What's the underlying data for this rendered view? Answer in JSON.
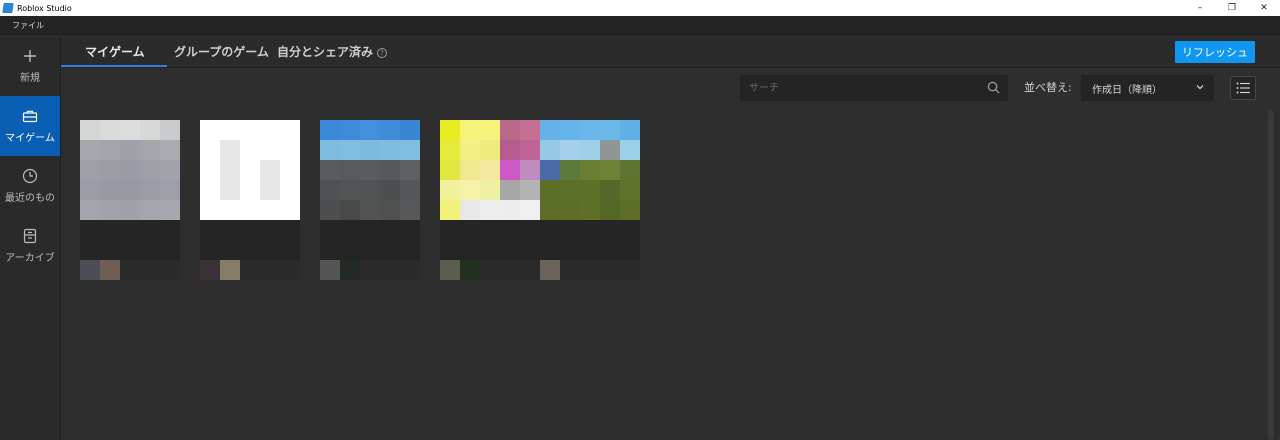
{
  "window": {
    "title": "Roblox Studio",
    "controls": [
      "–",
      "❐",
      "✕"
    ]
  },
  "menu": {
    "file": "ファイル"
  },
  "sidebar": {
    "items": [
      {
        "label": "新規",
        "icon": "plus-icon"
      },
      {
        "label": "マイゲーム",
        "icon": "briefcase-icon",
        "active": true
      },
      {
        "label": "最近のもの",
        "icon": "clock-icon"
      },
      {
        "label": "アーカイブ",
        "icon": "archive-icon"
      }
    ]
  },
  "tabs": {
    "my_games": "マイゲーム",
    "group_games": "グループのゲーム",
    "shared": "自分とシェア済み",
    "help": "?"
  },
  "refresh_button": "リフレッシュ",
  "search": {
    "placeholder": "サーチ",
    "value": ""
  },
  "sort": {
    "label": "並べ替え:",
    "selected": "作成日（降順）"
  },
  "colors": {
    "accent": "#0a5fb4",
    "refresh": "#1098f0",
    "background": "#2e2e2e"
  },
  "games": [
    {
      "title": "",
      "thumb": [
        "#d4d6d5",
        "#d9dbd9",
        "#dcdedd",
        "#d6d8d8",
        "#c9cbcc",
        "#a6a8ad",
        "#a2a4aa",
        "#9fa2a8",
        "#a4a6ab",
        "#a9abb0",
        "#9ea0a8",
        "#9b9da5",
        "#999ca4",
        "#9ea0a8",
        "#a0a3aa",
        "#9a9da6",
        "#989ba4",
        "#979aa3",
        "#9a9da6",
        "#9c9fa8",
        "#a3a5ad",
        "#a1a3ab",
        "#a0a2aa",
        "#a4a6ae",
        "#a6a8b0"
      ],
      "avatars": [
        "#4b4d57",
        "#6e5e54"
      ]
    },
    {
      "title": "",
      "thumb": [
        "#ffffff",
        "#ffffff",
        "#ffffff",
        "#ffffff",
        "#ffffff",
        "#ffffff",
        "#e6e6e6",
        "#ffffff",
        "#ffffff",
        "#ffffff",
        "#ffffff",
        "#e6e6e6",
        "#ffffff",
        "#e6e6e6",
        "#ffffff",
        "#ffffff",
        "#e6e6e6",
        "#ffffff",
        "#e6e6e6",
        "#ffffff",
        "#ffffff",
        "#ffffff",
        "#ffffff",
        "#ffffff",
        "#ffffff"
      ],
      "avatars": [
        "#3a3138",
        "#857c66"
      ]
    },
    {
      "title": "",
      "thumb": [
        "#3b88d6",
        "#3d8ad9",
        "#428fdc",
        "#3f8bd8",
        "#3a86d3",
        "#7dbbe0",
        "#80bde1",
        "#7cbadf",
        "#7ebce0",
        "#81bee2",
        "#5a5b5d",
        "#58595b",
        "#5b5c5e",
        "#575859",
        "#5e5f61",
        "#4f5051",
        "#535455",
        "#515253",
        "#4d4e4f",
        "#555657",
        "#4d4e4f",
        "#484949",
        "#525353",
        "#4f5050",
        "#575859"
      ],
      "avatars": [
        "#555555",
        "#232a24"
      ]
    },
    {
      "title": "",
      "thumb": [
        "#e8ec20",
        "#f4f27a",
        "#f6f27c",
        "#b86a86",
        "#c46f94",
        "#e6ea38",
        "#f4ee84",
        "#f1ea7c",
        "#b65a92",
        "#bf6497",
        "#e2e640",
        "#f2e890",
        "#f6e89c",
        "#cf58c7",
        "#c18abc",
        "#f2f09a",
        "#f6f2a8",
        "#eef0a4",
        "#a7a7a7",
        "#b3b3b3",
        "#f0f27c",
        "#e8e8e8",
        "#eeeeee",
        "#ededed",
        "#efefef"
      ],
      "avatars": [
        "#5b5e4f",
        "#22301f"
      ]
    },
    {
      "title": "",
      "thumb": [
        "#64b2e8",
        "#66b4ea",
        "#6ab6ea",
        "#6bb8eb",
        "#5fb0e6",
        "#96c9e6",
        "#a3d0ea",
        "#9fcfe8",
        "#8e9698",
        "#9acfe5",
        "#4a6aa6",
        "#5c7a3c",
        "#6b7e33",
        "#6f8235",
        "#5d7330",
        "#5c6e27",
        "#5d6f28",
        "#5f7129",
        "#57692a",
        "#60722a",
        "#5b6d26",
        "#5c6e27",
        "#5f7128",
        "#546624",
        "#5d6f27"
      ],
      "avatars": [
        "#6b625a",
        "#2a2a2a"
      ]
    }
  ]
}
